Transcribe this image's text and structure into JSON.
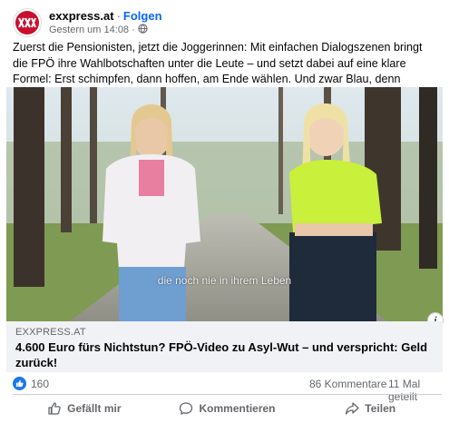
{
  "post": {
    "page_name": "exxpress.at",
    "separator": "·",
    "follow_label": "Folgen",
    "timestamp": "Gestern um 14:08",
    "time_dot": "·",
    "privacy_icon": "globe-icon",
    "text": "Zuerst die Pensionisten, jetzt die Joggerinnen: Mit einfachen Dialogszenen bringt die FPÖ ihre Wahlbotschaften unter die Leute – und setzt dabei auf eine klare Formel: Erst schimpfen, dann hoffen, am Ende wählen. Und zwar Blau, denn Dominik Nepp gibt den Menschen das Geld zurück."
  },
  "media": {
    "subtitle": "die noch nie in ihrem Leben",
    "info_label": "i"
  },
  "link": {
    "domain": "EXXPRESS.AT",
    "title": "4.600 Euro fürs Nichtstun? FPÖ-Video zu Asyl-Wut – und verspricht: Geld zurück!"
  },
  "stats": {
    "likes": "160",
    "comments": "86 Kommentare",
    "shares": "11 Mal geteilt"
  },
  "actions": {
    "like": "Gefällt mir",
    "comment": "Kommentieren",
    "share": "Teilen"
  },
  "colors": {
    "accent": "#0866ff",
    "brand_red": "#c8102e",
    "muted": "#65676b",
    "link_bg": "#f0f2f5"
  }
}
